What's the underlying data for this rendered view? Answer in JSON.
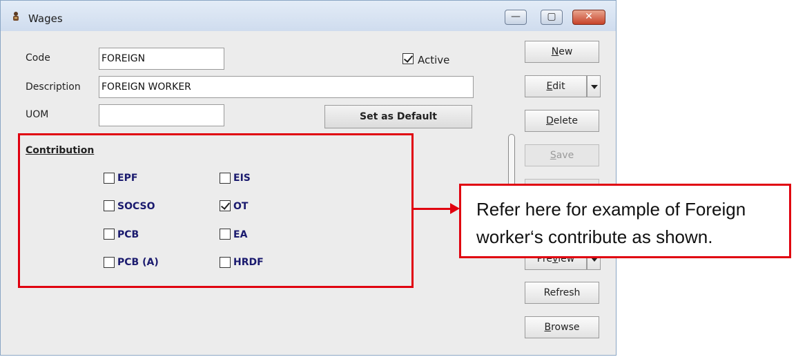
{
  "window": {
    "title": "Wages",
    "controls": {
      "minimize": "—",
      "maximize": "▢",
      "close": "✕"
    }
  },
  "form": {
    "code_label": "Code",
    "code_value": "FOREIGN",
    "description_label": "Description",
    "description_value": "FOREIGN WORKER",
    "uom_label": "UOM",
    "uom_value": "",
    "active_label": "Active",
    "active_checked": true,
    "set_default_label": "Set as Default"
  },
  "contribution": {
    "title": "Contribution",
    "items": [
      {
        "label": "EPF",
        "checked": false
      },
      {
        "label": "EIS",
        "checked": false
      },
      {
        "label": "SOCSO",
        "checked": false
      },
      {
        "label": "OT",
        "checked": true
      },
      {
        "label": "PCB",
        "checked": false
      },
      {
        "label": "EA",
        "checked": false
      },
      {
        "label": "PCB (A)",
        "checked": false
      },
      {
        "label": "HRDF",
        "checked": false
      }
    ]
  },
  "buttons": {
    "new": {
      "pre": "",
      "ul": "N",
      "post": "ew"
    },
    "edit": {
      "pre": "",
      "ul": "E",
      "post": "dit"
    },
    "delete": {
      "pre": "",
      "ul": "D",
      "post": "elete"
    },
    "save": {
      "pre": "",
      "ul": "S",
      "post": "ave"
    },
    "preview": {
      "pre": "Pre",
      "ul": "v",
      "post": "iew"
    },
    "refresh": {
      "pre": "Refresh",
      "ul": "",
      "post": ""
    },
    "browse": {
      "pre": "",
      "ul": "B",
      "post": "rowse"
    }
  },
  "callout": {
    "text": "Refer here for example of Foreign worker‘s contribute as shown."
  },
  "colors": {
    "annotation_red": "#e0000f",
    "label_blue": "#1a1a6e"
  },
  "icons": {
    "app": "wages-app-icon",
    "dropdown": "chevron-down-icon"
  }
}
